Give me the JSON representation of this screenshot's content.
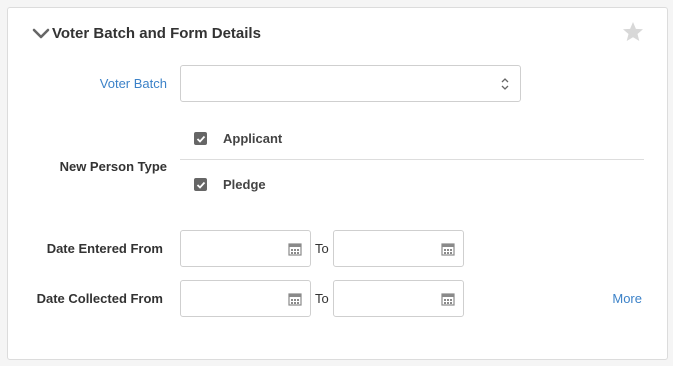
{
  "section": {
    "title": "Voter Batch and Form Details"
  },
  "voter_batch": {
    "label": "Voter Batch",
    "value": ""
  },
  "new_person_type": {
    "label": "New Person Type",
    "options": [
      {
        "label": "Applicant",
        "checked": true
      },
      {
        "label": "Pledge",
        "checked": true
      }
    ]
  },
  "date_entered": {
    "label": "Date Entered From",
    "to_label": "To",
    "from_value": "",
    "to_value": ""
  },
  "date_collected": {
    "label": "Date Collected From",
    "to_label": "To",
    "from_value": "",
    "to_value": ""
  },
  "more_link": "More",
  "colors": {
    "accent": "#3c82c8",
    "checkbox": "#666666",
    "border": "#cfcfcf"
  },
  "icons": {
    "collapse": "chevron-down-icon",
    "favorite": "star-icon",
    "select": "select-arrows-icon",
    "calendar": "calendar-icon",
    "check": "checkmark-icon"
  }
}
